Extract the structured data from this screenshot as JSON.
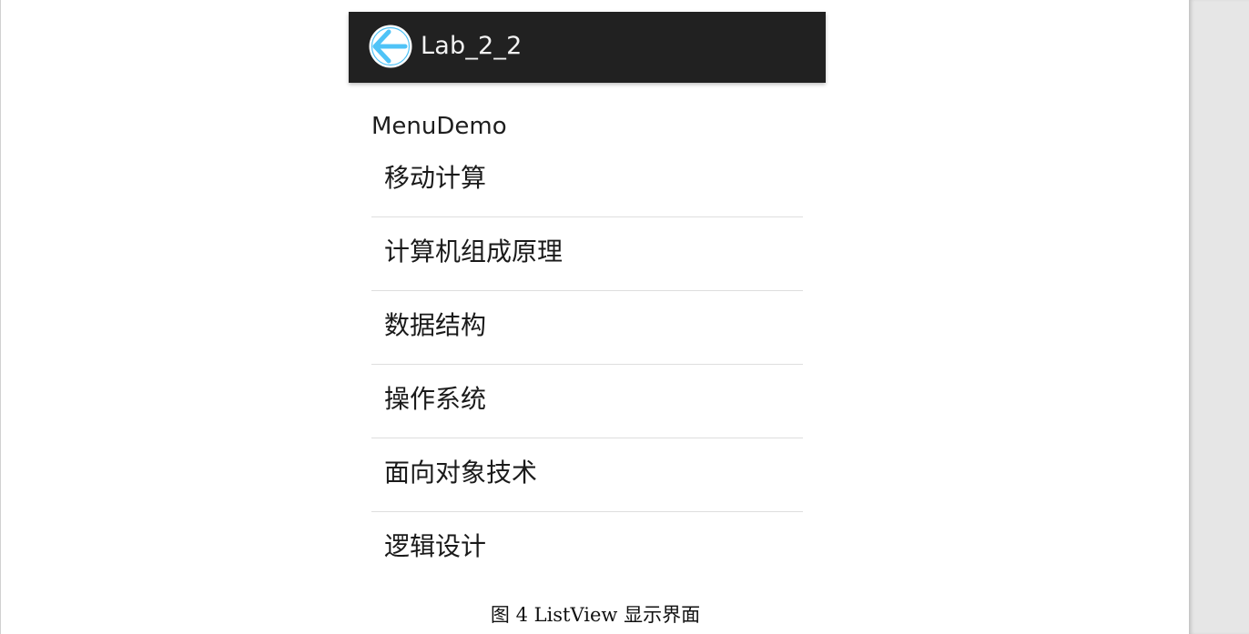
{
  "app": {
    "title": "Lab_2_2",
    "back_icon": "arrow-left-circle-icon",
    "action_bar_color": "#212121",
    "accent_color": "#4fc3f7"
  },
  "list_header": "MenuDemo",
  "list_items": [
    {
      "label": "移动计算"
    },
    {
      "label": "计算机组成原理"
    },
    {
      "label": "数据结构"
    },
    {
      "label": "操作系统"
    },
    {
      "label": "面向对象技术"
    },
    {
      "label": "逻辑设计"
    }
  ],
  "caption": "图 4 ListView 显示界面"
}
